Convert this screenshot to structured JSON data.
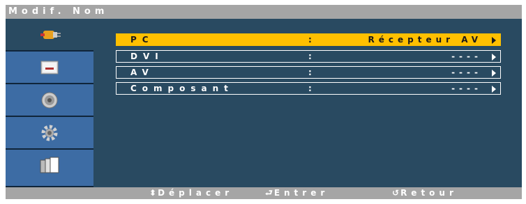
{
  "title": "Modif. Nom",
  "sidebar": {
    "items": [
      {
        "icon": "input-plug-icon",
        "active": true
      },
      {
        "icon": "picture-icon",
        "active": false
      },
      {
        "icon": "speaker-icon",
        "active": false
      },
      {
        "icon": "setup-gear-icon",
        "active": false
      },
      {
        "icon": "multi-window-icon",
        "active": false
      }
    ]
  },
  "menu": {
    "rows": [
      {
        "label": "PC",
        "colon": ":",
        "value": "Récepteur AV",
        "selected": true
      },
      {
        "label": "DVI",
        "colon": ":",
        "value": "----",
        "selected": false
      },
      {
        "label": "AV",
        "colon": ":",
        "value": "----",
        "selected": false
      },
      {
        "label": "Composant",
        "colon": ":",
        "value": "----",
        "selected": false
      }
    ]
  },
  "footer": {
    "move": {
      "icon": "⬍",
      "label": "Déplacer"
    },
    "enter": {
      "icon": "⮐",
      "label": "Entrer"
    },
    "back": {
      "icon": "↺",
      "label": "Retour"
    }
  },
  "colors": {
    "background": "#294a61",
    "bar": "#a5a5a5",
    "sidebar_item": "#3d6ca4",
    "highlight": "#ffc000"
  }
}
